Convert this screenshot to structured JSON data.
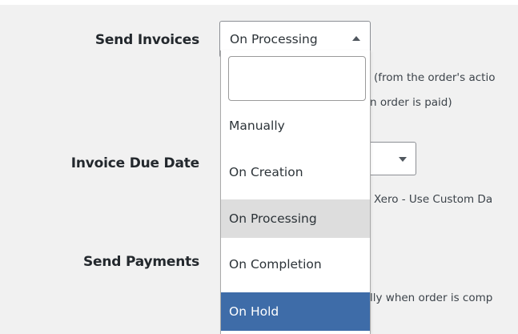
{
  "settings": {
    "send_invoices": {
      "label": "Send Invoices",
      "selected": "On Processing",
      "description_line1": "(from the order's actio",
      "description_line2": "n order is paid)"
    },
    "invoice_due_date": {
      "label": "Invoice Due Date",
      "description": "Xero - Use Custom Da"
    },
    "send_payments": {
      "label": "Send Payments",
      "description": "lly when order is comp"
    }
  },
  "dropdown": {
    "search_value": "",
    "options": [
      {
        "label": "Manually",
        "state": "normal"
      },
      {
        "label": "On Creation",
        "state": "normal"
      },
      {
        "label": "On Processing",
        "state": "selected"
      },
      {
        "label": "On Completion",
        "state": "normal"
      },
      {
        "label": "On Hold",
        "state": "highlighted"
      }
    ]
  },
  "colors": {
    "panel_background": "#f1f1f1",
    "highlight": "#3e6ca8",
    "selected": "#dddddd"
  },
  "icons": {
    "send_invoices_select": "chevron-up-icon",
    "invoice_due_date_select": "chevron-down-icon"
  }
}
